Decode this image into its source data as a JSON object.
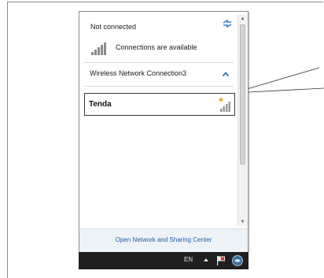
{
  "status": {
    "title": "Not connected",
    "message": "Connections are available"
  },
  "section": {
    "label": "Wireless Network Connection3"
  },
  "networks": [
    {
      "name": "Tenda",
      "icon": "wifi-signal-icon"
    }
  ],
  "footer": {
    "link": "Open Network and Sharing Center"
  },
  "taskbar": {
    "language": "EN"
  },
  "colors": {
    "link": "#1c5ea8",
    "taskbar": "#1f1f1f",
    "footer_bg": "#eef3f8",
    "signal_star": "#e6a020",
    "refresh": "#2f7fd1"
  }
}
